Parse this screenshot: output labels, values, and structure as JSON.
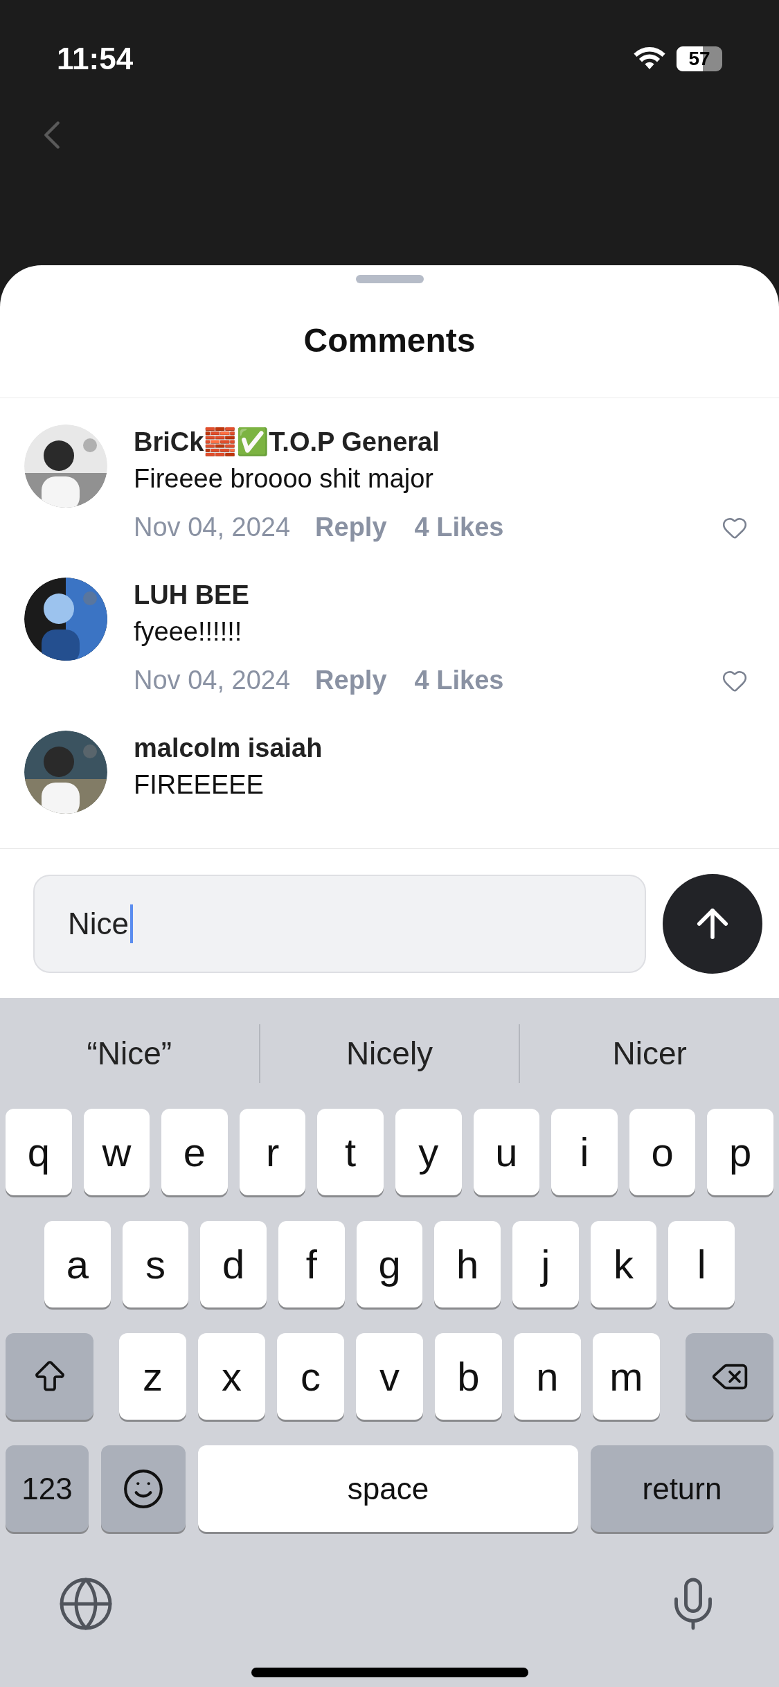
{
  "status_bar": {
    "time": "11:54",
    "battery": "57"
  },
  "sheet": {
    "title": "Comments"
  },
  "comments": [
    {
      "author": "BriCk🧱✅T.O.P General",
      "text": "Fireeee broooo shit major",
      "date": "Nov 04, 2024",
      "reply": "Reply",
      "likes": "4 Likes"
    },
    {
      "author": "LUH BEE",
      "text": "fyeee!!!!!!",
      "date": "Nov 04, 2024",
      "reply": "Reply",
      "likes": "4 Likes"
    },
    {
      "author": "malcolm isaiah",
      "text": "FIREEEEE"
    }
  ],
  "composer": {
    "value": "Nice"
  },
  "suggestions": [
    "“Nice”",
    "Nicely",
    "Nicer"
  ],
  "keyboard": [
    [
      {
        "kind": "letter",
        "label": "q"
      },
      {
        "kind": "letter",
        "label": "w"
      },
      {
        "kind": "letter",
        "label": "e"
      },
      {
        "kind": "letter",
        "label": "r"
      },
      {
        "kind": "letter",
        "label": "t"
      },
      {
        "kind": "letter",
        "label": "y"
      },
      {
        "kind": "letter",
        "label": "u"
      },
      {
        "kind": "letter",
        "label": "i"
      },
      {
        "kind": "letter",
        "label": "o"
      },
      {
        "kind": "letter",
        "label": "p"
      }
    ],
    [
      {
        "kind": "letter",
        "label": "a"
      },
      {
        "kind": "letter",
        "label": "s"
      },
      {
        "kind": "letter",
        "label": "d"
      },
      {
        "kind": "letter",
        "label": "f"
      },
      {
        "kind": "letter",
        "label": "g"
      },
      {
        "kind": "letter",
        "label": "h"
      },
      {
        "kind": "letter",
        "label": "j"
      },
      {
        "kind": "letter",
        "label": "k"
      },
      {
        "kind": "letter",
        "label": "l"
      }
    ],
    [
      {
        "kind": "shift"
      },
      {
        "kind": "letter",
        "label": "z"
      },
      {
        "kind": "letter",
        "label": "x"
      },
      {
        "kind": "letter",
        "label": "c"
      },
      {
        "kind": "letter",
        "label": "v"
      },
      {
        "kind": "letter",
        "label": "b"
      },
      {
        "kind": "letter",
        "label": "n"
      },
      {
        "kind": "letter",
        "label": "m"
      },
      {
        "kind": "delete"
      }
    ],
    [
      {
        "kind": "numbers",
        "label": "123"
      },
      {
        "kind": "emoji"
      },
      {
        "kind": "space",
        "label": "space"
      },
      {
        "kind": "return",
        "label": "return"
      }
    ]
  ]
}
